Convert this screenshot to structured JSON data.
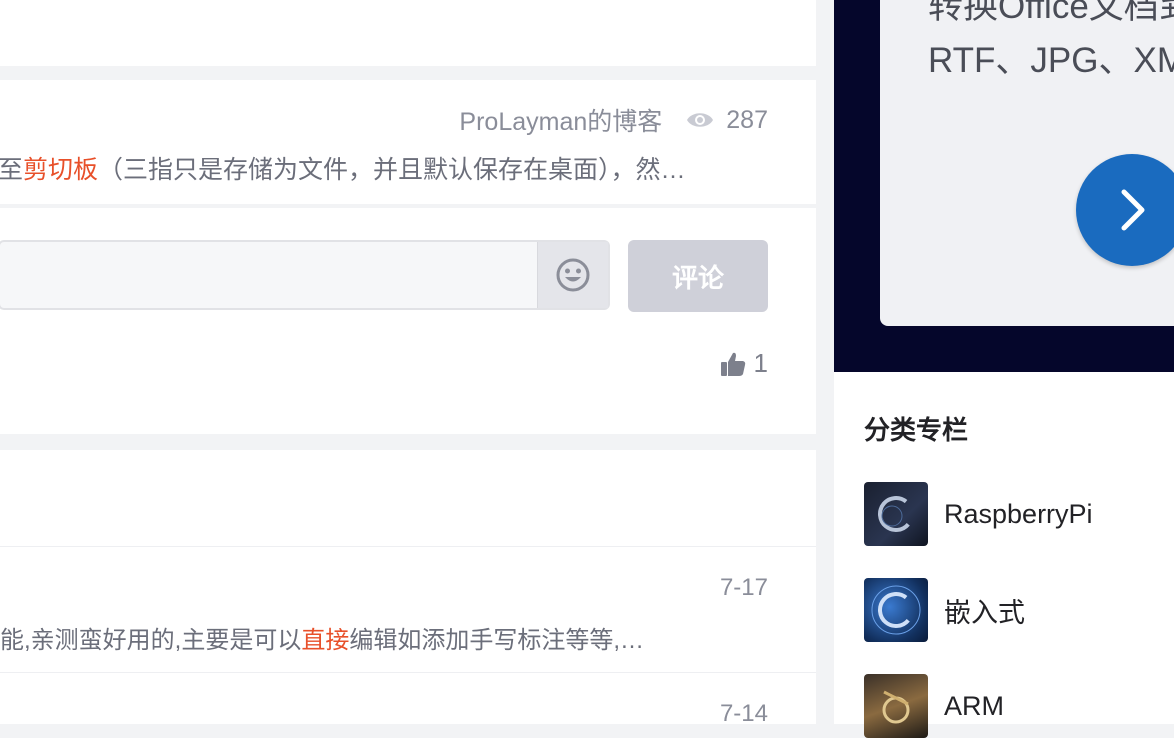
{
  "article": {
    "author": "ProLayman的博客",
    "views": "287",
    "snippet_pre": "至",
    "snippet_hl": "剪切板",
    "snippet_post": "（三指只是存储为文件，并且默认保存在桌面），然…"
  },
  "comment": {
    "input_placeholder": "",
    "submit_label": "评论",
    "like_count": "1"
  },
  "related": [
    {
      "date": "7-17",
      "snippet_pre": "能,亲测蛮好用的,主要是可以",
      "snippet_hl": "直接",
      "snippet_post": "编辑如添加手写标注等等,…"
    },
    {
      "date": "7-14"
    }
  ],
  "promo": {
    "line1": "转换Office文档到",
    "line2": "RTF、JPG、XM",
    "next_icon": "chevron-right-icon"
  },
  "sidebar": {
    "category_title": "分类专栏",
    "categories": [
      {
        "label": "RaspberryPi"
      },
      {
        "label": "嵌入式"
      },
      {
        "label": "ARM"
      }
    ]
  },
  "colors": {
    "highlight": "#e8502a",
    "accent_blue": "#1a6bbf",
    "promo_bg": "#05062b"
  }
}
